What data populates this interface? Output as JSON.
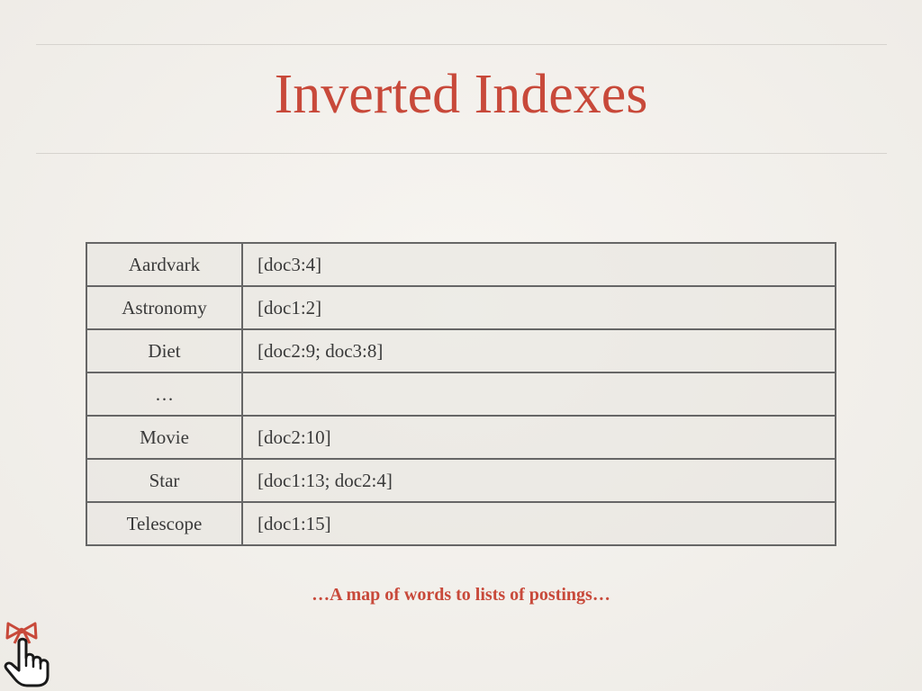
{
  "slide": {
    "title": "Inverted Indexes",
    "caption": "…A map of words to lists of postings…"
  },
  "index_table": {
    "rows": [
      {
        "term": "Aardvark",
        "postings": "[doc3:4]"
      },
      {
        "term": "Astronomy",
        "postings": "[doc1:2]"
      },
      {
        "term": "Diet",
        "postings": "[doc2:9; doc3:8]"
      },
      {
        "term": "…",
        "postings": ""
      },
      {
        "term": "Movie",
        "postings": "[doc2:10]"
      },
      {
        "term": "Star",
        "postings": "[doc1:13; doc2:4]"
      },
      {
        "term": "Telescope",
        "postings": "[doc1:15]"
      }
    ]
  },
  "colors": {
    "accent": "#c8493a",
    "border": "#666666",
    "text": "#3a3a3a"
  },
  "icons": {
    "pointer": "pointing-hand-with-ribbon-icon"
  }
}
